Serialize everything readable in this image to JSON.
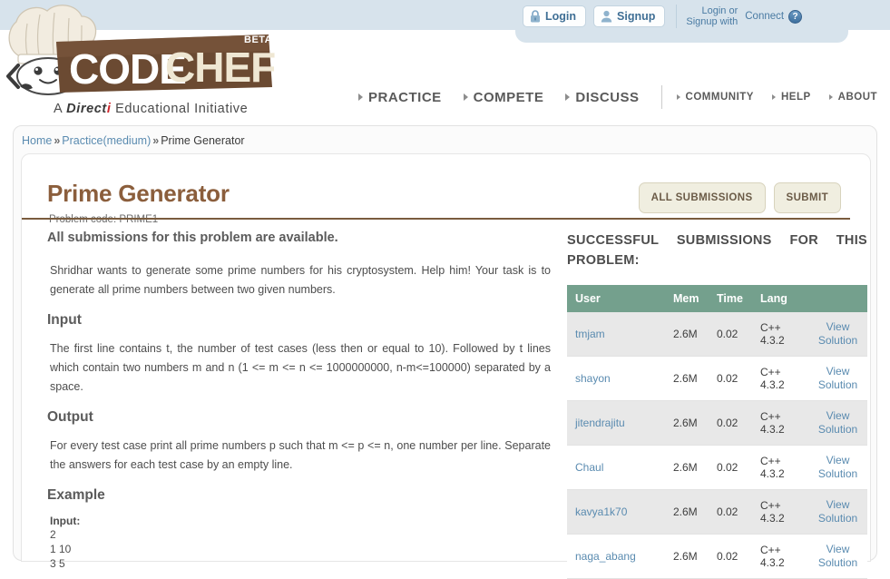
{
  "brand": {
    "name": "CODECHEF",
    "beta": "BETA",
    "tagline_pre": "A",
    "tagline_brand": "Direct",
    "tagline_brand_i": "i",
    "tagline_post": "Educational Initiative"
  },
  "auth": {
    "login_label": "Login",
    "signup_label": "Signup",
    "login_or_line1": "Login or",
    "login_or_line2": "Signup with",
    "connect_label": "Connect",
    "connect_badge": "?"
  },
  "nav": {
    "main": [
      {
        "label": "PRACTICE"
      },
      {
        "label": "COMPETE"
      },
      {
        "label": "DISCUSS"
      }
    ],
    "secondary": [
      {
        "label": "COMMUNITY"
      },
      {
        "label": "HELP"
      },
      {
        "label": "ABOUT"
      }
    ]
  },
  "breadcrumb": {
    "home": "Home",
    "sep1": "»",
    "section": "Practice(medium)",
    "sep2": "»",
    "current": "Prime Generator"
  },
  "problem": {
    "title": "Prime Generator",
    "code_label": "Problem code: PRIME1",
    "all_submissions_btn": "ALL SUBMISSIONS",
    "submit_btn": "SUBMIT",
    "availability_note": "All submissions for this problem are available.",
    "statement": "Shridhar wants to generate some prime numbers for his cryptosystem. Help him! Your task is to generate all prime numbers between two given numbers.",
    "input_heading": "Input",
    "input_text": "The first line contains t, the number of test cases (less then or equal to 10). Followed by t lines which contain two numbers m and n (1 <= m <= n <= 1000000000, n-m<=100000) separated by a space.",
    "output_heading": "Output",
    "output_text": "For every test case print all prime numbers p such that m <= p <= n, one number per line. Separate the answers for each test case by an empty line.",
    "example_heading": "Example",
    "example_input_label": "Input:",
    "example_input_lines": [
      "2",
      "1 10",
      "3 5"
    ]
  },
  "submissions": {
    "title": "SUCCESSFUL SUBMISSIONS FOR THIS PROBLEM:",
    "columns": [
      "User",
      "Mem",
      "Time",
      "Lang",
      ""
    ],
    "view_label_line1": "View",
    "view_label_line2": "Solution",
    "rows": [
      {
        "user": "tmjam",
        "mem": "2.6M",
        "time": "0.02",
        "lang_line1": "C++",
        "lang_line2": "4.3.2"
      },
      {
        "user": "shayon",
        "mem": "2.6M",
        "time": "0.02",
        "lang_line1": "C++",
        "lang_line2": "4.3.2"
      },
      {
        "user": "jitendrajitu",
        "mem": "2.6M",
        "time": "0.02",
        "lang_line1": "C++",
        "lang_line2": "4.3.2"
      },
      {
        "user": "Chaul",
        "mem": "2.6M",
        "time": "0.02",
        "lang_line1": "C++",
        "lang_line2": "4.3.2"
      },
      {
        "user": "kavya1k70",
        "mem": "2.6M",
        "time": "0.02",
        "lang_line1": "C++",
        "lang_line2": "4.3.2"
      },
      {
        "user": "naga_abang",
        "mem": "2.6M",
        "time": "0.02",
        "lang_line1": "C++",
        "lang_line2": "4.3.2"
      }
    ]
  },
  "colors": {
    "top_band": "#d7e3ec",
    "table_header": "#74a08d",
    "title_brown": "#8b5e3c",
    "link_blue": "#5a8bb0",
    "button_cream": "#f0eee0"
  }
}
